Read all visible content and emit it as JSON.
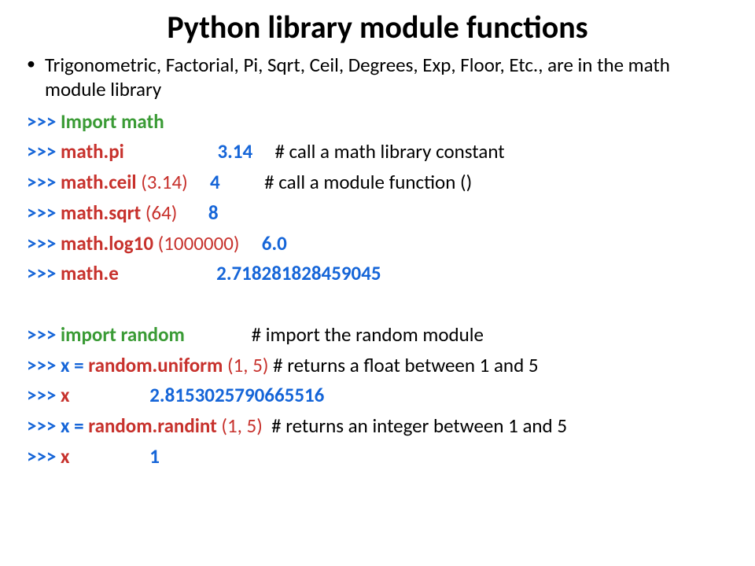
{
  "title": "Python library module functions",
  "bullet": "Trigonometric, Factorial, Pi, Sqrt, Ceil, Degrees, Exp, Floor, Etc., are in the math module library",
  "lines": {
    "l1": {
      "prompt": ">>> ",
      "green": "Import math"
    },
    "l2": {
      "prompt": ">>> ",
      "red": "math.pi",
      "pad1": "                     ",
      "result": "3.14",
      "pad2": "     ",
      "comment": "# call a math library constant"
    },
    "l3": {
      "prompt": ">>> ",
      "red": "math.ceil",
      "redn": " (3.14)",
      "pad1": "     ",
      "result": "4",
      "pad2": "          ",
      "comment": "# call a module function ()"
    },
    "l4": {
      "prompt": ">>> ",
      "red": "math.sqrt",
      "redn": " (64)",
      "pad1": "       ",
      "result": "8"
    },
    "l5": {
      "prompt": ">>> ",
      "red": "math.log10",
      "redn": " (1000000)",
      "pad1": "     ",
      "result": "6.0"
    },
    "l6": {
      "prompt": ">>> ",
      "red": "math.e",
      "pad1": "                      ",
      "result": "2.718281828459045"
    },
    "l7": {
      "prompt": ">>> ",
      "green": "import random",
      "pad1": "               ",
      "comment": "# import the random module"
    },
    "l8": {
      "prompt": ">>> ",
      "blue": "x = ",
      "red": "random.uniform",
      "redn": " (1, 5) ",
      "comment": "# returns a float between 1 and 5"
    },
    "l9": {
      "prompt": ">>> ",
      "red": "x",
      "pad1": "                  ",
      "result": "2.8153025790665516"
    },
    "l10": {
      "prompt": ">>> ",
      "blue": "x = ",
      "red": "random.randint",
      "redn": " (1, 5)",
      "pad1": "  ",
      "comment": "# returns an integer between 1 and 5"
    },
    "l11": {
      "prompt": ">>> ",
      "red": "x",
      "pad1": "                  ",
      "result": "1"
    }
  }
}
